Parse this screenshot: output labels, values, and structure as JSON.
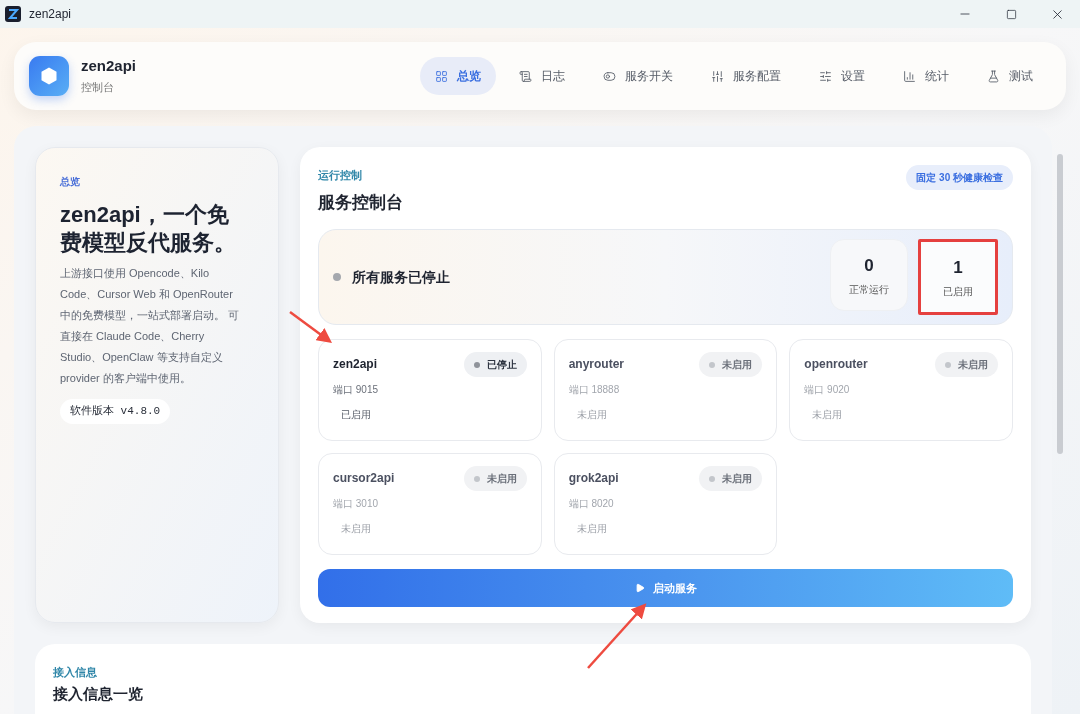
{
  "window": {
    "title": "zen2api"
  },
  "brand": {
    "name": "zen2api",
    "subtitle": "控制台"
  },
  "nav": [
    {
      "label": "总览",
      "selected": true
    },
    {
      "label": "日志",
      "selected": false
    },
    {
      "label": "服务开关",
      "selected": false
    },
    {
      "label": "服务配置",
      "selected": false
    },
    {
      "label": "设置",
      "selected": false
    },
    {
      "label": "统计",
      "selected": false
    },
    {
      "label": "测试",
      "selected": false
    }
  ],
  "intro": {
    "eyebrow": "总览",
    "title": "zen2api，一个免费模型反代服务。",
    "description": "上游接口使用 Opencode、Kilo Code、Cursor Web 和 OpenRouter 中的免费模型，一站式部署启动。 可直接在 Claude Code、Cherry Studio、OpenClaw 等支持自定义 provider 的客户端中使用。",
    "version": "软件版本 v4.8.0"
  },
  "control": {
    "eyebrow": "运行控制",
    "title": "服务控制台",
    "badge": "固定 30 秒健康检查",
    "status": "所有服务已停止",
    "stats": [
      {
        "value": "0",
        "label": "正常运行",
        "highlighted": false
      },
      {
        "value": "1",
        "label": "已启用",
        "highlighted": true
      }
    ],
    "services": [
      {
        "name": "zen2api",
        "badge": "已停止",
        "port": "端口 9015",
        "state": "已启用",
        "enabled": true
      },
      {
        "name": "anyrouter",
        "badge": "未启用",
        "port": "端口 18888",
        "state": "未启用",
        "enabled": false
      },
      {
        "name": "openrouter",
        "badge": "未启用",
        "port": "端口 9020",
        "state": "未启用",
        "enabled": false
      },
      {
        "name": "cursor2api",
        "badge": "未启用",
        "port": "端口 3010",
        "state": "未启用",
        "enabled": false
      },
      {
        "name": "grok2api",
        "badge": "未启用",
        "port": "端口 8020",
        "state": "未启用",
        "enabled": false
      }
    ],
    "start_button": "启动服务"
  },
  "access": {
    "eyebrow": "接入信息",
    "title": "接入信息一览"
  }
}
